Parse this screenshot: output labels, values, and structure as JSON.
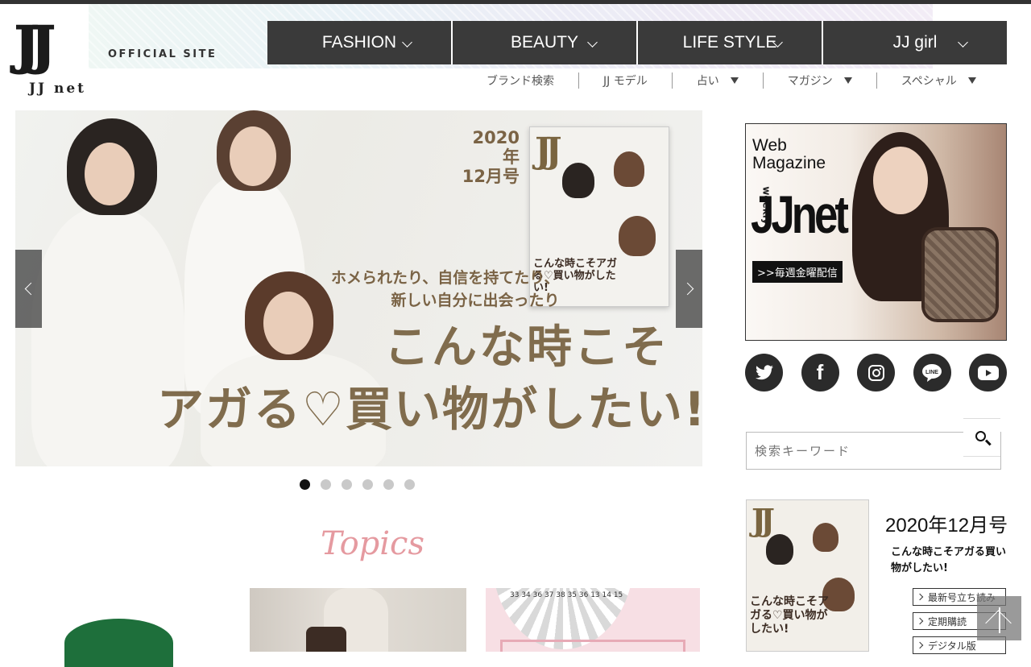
{
  "header": {
    "logo_mark": "JJ",
    "logo_sub": "JJ net",
    "official": "OFFICIAL SITE"
  },
  "main_nav": [
    "FASHION",
    "BEAUTY",
    "LIFE STYLE",
    "JJ girl"
  ],
  "sub_nav": {
    "brand": "ブランド検索",
    "model": "JJ モデル",
    "fortune": "占い",
    "magazine": "マガジン",
    "special": "スペシャル"
  },
  "slider": {
    "date_line1": "2020年",
    "date_line2": "12月号",
    "lead_line1": "ホメられたり、自信を持てたり、",
    "lead_line2": "新しい自分に出会ったり",
    "headline1": "こんな時こそ",
    "headline2": "アガる♡買い物がしたい!",
    "cover_logo": "JJ",
    "cover_text": "こんな時こそアガる♡買い物がしたい!",
    "dots_active": 0,
    "dots_count": 6
  },
  "topics": {
    "title": "Topics",
    "card2_nums": "33 34 36 37 38 35 36 13 14 15"
  },
  "sidebar": {
    "banner_web": "Web",
    "banner_magazine": "Magazine",
    "banner_weekly": "weekly",
    "banner_jjnet": "JJnet",
    "banner_tag": ">>毎週金曜配信",
    "social": [
      "twitter-icon",
      "facebook-icon",
      "instagram-icon",
      "line-icon",
      "youtube-icon"
    ],
    "search_placeholder": "検索キーワード",
    "mag_logo": "JJ",
    "mag_cover_text": "こんな時こそアガる♡買い物がしたい!",
    "issue": "2020年12月号",
    "issue_desc": "こんな時こそアガる買い物がしたい!",
    "buttons": [
      "最新号立ち読み",
      "定期購読",
      "デジタル版"
    ]
  },
  "colors": {
    "nav_bg": "#3a3a3a",
    "headline": "#806c4d",
    "topics": "#e59aa0"
  }
}
